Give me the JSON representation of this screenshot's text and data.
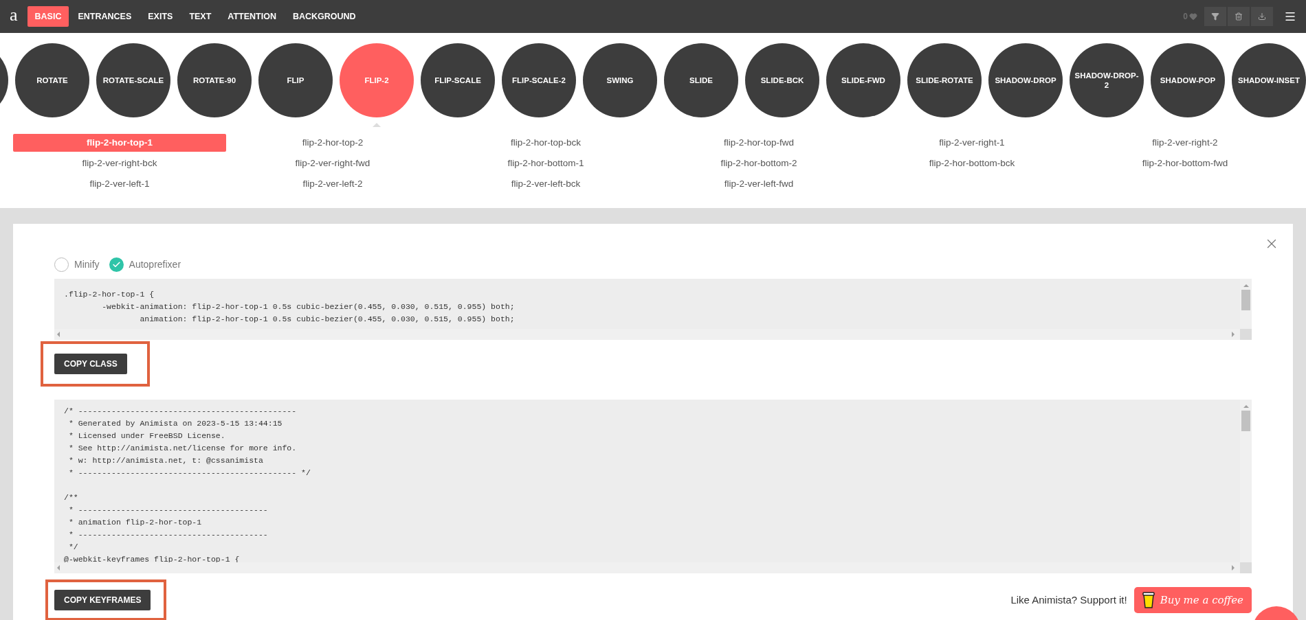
{
  "topbar": {
    "logo": "a",
    "tabs": [
      {
        "label": "BASIC",
        "selected": true
      },
      {
        "label": "ENTRANCES",
        "selected": false
      },
      {
        "label": "EXITS",
        "selected": false
      },
      {
        "label": "TEXT",
        "selected": false
      },
      {
        "label": "ATTENTION",
        "selected": false
      },
      {
        "label": "BACKGROUND",
        "selected": false
      }
    ],
    "favorites_count": "0"
  },
  "categories": [
    {
      "label": "ROTATE",
      "selected": false
    },
    {
      "label": "ROTATE-SCALE",
      "selected": false
    },
    {
      "label": "ROTATE-90",
      "selected": false
    },
    {
      "label": "FLIP",
      "selected": false
    },
    {
      "label": "FLIP-2",
      "selected": true
    },
    {
      "label": "FLIP-SCALE",
      "selected": false
    },
    {
      "label": "FLIP-SCALE-2",
      "selected": false
    },
    {
      "label": "SWING",
      "selected": false
    },
    {
      "label": "SLIDE",
      "selected": false
    },
    {
      "label": "SLIDE-BCK",
      "selected": false
    },
    {
      "label": "SLIDE-FWD",
      "selected": false
    },
    {
      "label": "SLIDE-ROTATE",
      "selected": false
    },
    {
      "label": "SHADOW-DROP",
      "selected": false
    },
    {
      "label": "SHADOW-DROP-2",
      "selected": false
    },
    {
      "label": "SHADOW-POP",
      "selected": false
    },
    {
      "label": "SHADOW-INSET",
      "selected": false
    }
  ],
  "variants": [
    {
      "label": "flip-2-hor-top-1",
      "selected": true
    },
    {
      "label": "flip-2-hor-top-2",
      "selected": false
    },
    {
      "label": "flip-2-hor-top-bck",
      "selected": false
    },
    {
      "label": "flip-2-hor-top-fwd",
      "selected": false
    },
    {
      "label": "flip-2-ver-right-1",
      "selected": false
    },
    {
      "label": "flip-2-ver-right-2",
      "selected": false
    },
    {
      "label": "flip-2-ver-right-bck",
      "selected": false
    },
    {
      "label": "flip-2-ver-right-fwd",
      "selected": false
    },
    {
      "label": "flip-2-hor-bottom-1",
      "selected": false
    },
    {
      "label": "flip-2-hor-bottom-2",
      "selected": false
    },
    {
      "label": "flip-2-hor-bottom-bck",
      "selected": false
    },
    {
      "label": "flip-2-hor-bottom-fwd",
      "selected": false
    },
    {
      "label": "flip-2-ver-left-1",
      "selected": false
    },
    {
      "label": "flip-2-ver-left-2",
      "selected": false
    },
    {
      "label": "flip-2-ver-left-bck",
      "selected": false
    },
    {
      "label": "flip-2-ver-left-fwd",
      "selected": false
    }
  ],
  "options": [
    {
      "label": "Minify",
      "checked": false
    },
    {
      "label": "Autoprefixer",
      "checked": true
    }
  ],
  "class_code": {
    "lines": [
      ".flip-2-hor-top-1 {",
      "        -webkit-animation: flip-2-hor-top-1 0.5s cubic-bezier(0.455, 0.030, 0.515, 0.955) both;",
      "                animation: flip-2-hor-top-1 0.5s cubic-bezier(0.455, 0.030, 0.515, 0.955) both;"
    ]
  },
  "copy_class_button": "COPY CLASS",
  "keyframes_code": {
    "blocks": [
      [
        "/* ----------------------------------------------",
        " * Generated by Animista on 2023-5-15 13:44:15",
        " * Licensed under FreeBSD License.",
        " * See http://animista.net/license for more info.",
        " * w: http://animista.net, t: @cssanimista",
        " * ---------------------------------------------- */"
      ],
      [
        "/**",
        " * ----------------------------------------",
        " * animation flip-2-hor-top-1",
        " * ----------------------------------------",
        " */",
        "@-webkit-keyframes flip-2-hor-top-1 {"
      ]
    ]
  },
  "copy_keyframes_button": "COPY KEYFRAMES",
  "support": {
    "text": "Like Animista? Support it!",
    "button": "Buy me a coffee"
  }
}
